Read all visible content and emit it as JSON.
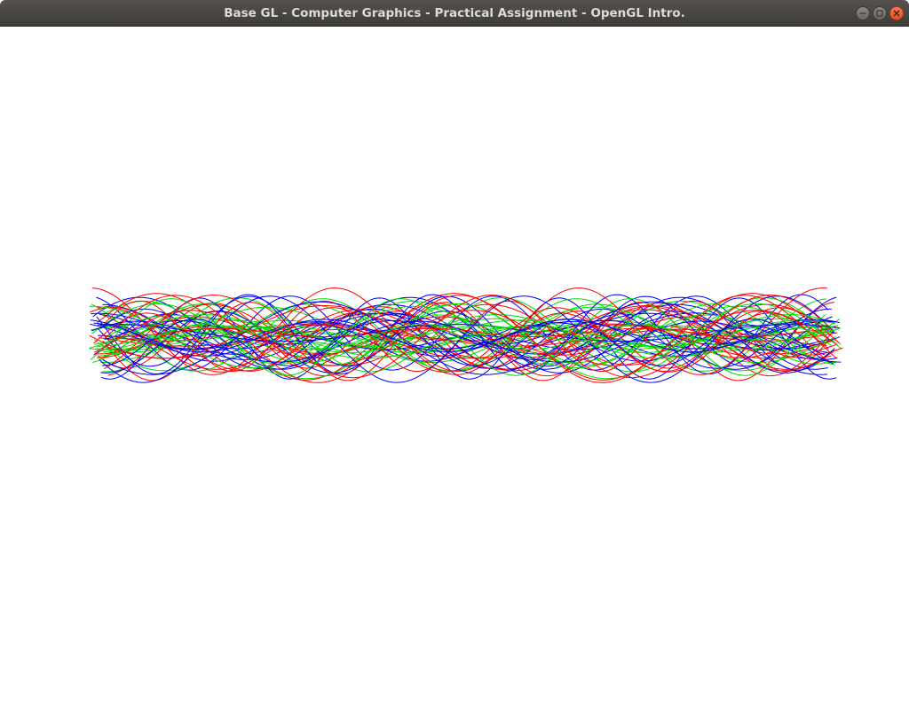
{
  "window": {
    "title": "Base GL - Computer Graphics - Practical Assignment - OpenGL Intro."
  },
  "controls": {
    "minimize_icon": "minimize-icon",
    "maximize_icon": "maximize-icon",
    "close_icon": "close-icon"
  },
  "colors": {
    "titlebar": "#46443f",
    "title_text": "#dfdbd2",
    "close_button": "#e95420",
    "canvas_background": "#ffffff",
    "curve_red": "#ff0000",
    "curve_green": "#00dd00",
    "curve_blue": "#0000ee"
  }
}
